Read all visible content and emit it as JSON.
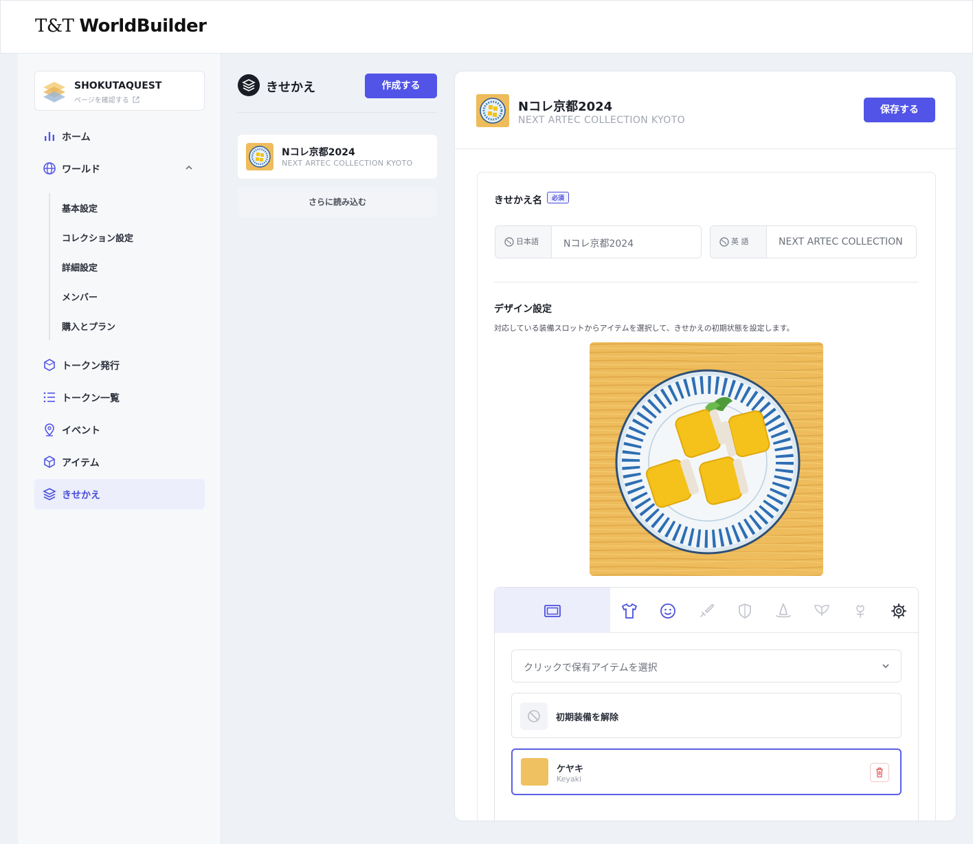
{
  "app": {
    "logo_prefix": "T&T",
    "logo_name": "WorldBuilder"
  },
  "sidebar": {
    "project_name": "SHOKUTAQUEST",
    "project_link": "ページを確認する",
    "items": [
      {
        "label": "ホーム",
        "icon": "bar-chart-icon"
      },
      {
        "label": "ワールド",
        "icon": "globe-icon"
      },
      {
        "label": "トークン発行",
        "icon": "hexagon-icon"
      },
      {
        "label": "トークン一覧",
        "icon": "list-icon"
      },
      {
        "label": "イベント",
        "icon": "map-pin-icon"
      },
      {
        "label": "アイテム",
        "icon": "box-icon"
      },
      {
        "label": "きせかえ",
        "icon": "layers-icon"
      }
    ],
    "world_sub": [
      "基本設定",
      "コレクション設定",
      "詳細設定",
      "メンバー",
      "購入とプラン"
    ]
  },
  "middle": {
    "title": "きせかえ",
    "create_label": "作成する",
    "card": {
      "title": "Nコレ京都2024",
      "subtitle": "NEXT ARTEC COLLECTION KYOTO"
    },
    "load_more": "さらに読み込む"
  },
  "panel": {
    "title": "Nコレ京都2024",
    "subtitle": "NEXT ARTEC COLLECTION KYOTO",
    "save_label": "保存する",
    "name_label": "きせかえ名",
    "required_badge": "必須",
    "ja": {
      "tag": "日本語",
      "value": "Nコレ京都2024"
    },
    "en": {
      "tag": "英 語",
      "value": "NEXT ARTEC COLLECTION"
    },
    "design_title": "デザイン設定",
    "design_desc": "対応している装備スロットからアイテムを選択して、きせかえの初期状態を設定します。",
    "slot_icons": [
      "frame-icon",
      "shirt-icon",
      "face-icon",
      "sword-icon",
      "shield-icon",
      "hat-icon",
      "wings-icon",
      "flower-icon",
      "gear-icon"
    ],
    "dropdown_placeholder": "クリックで保有アイテムを選択",
    "clear_label": "初期装備を解除",
    "selected_item": {
      "name": "ケヤキ",
      "sub": "Keyaki",
      "color": "#f0c160"
    }
  },
  "colors": {
    "accent": "#5154e6",
    "active_bg": "#eceefc"
  }
}
